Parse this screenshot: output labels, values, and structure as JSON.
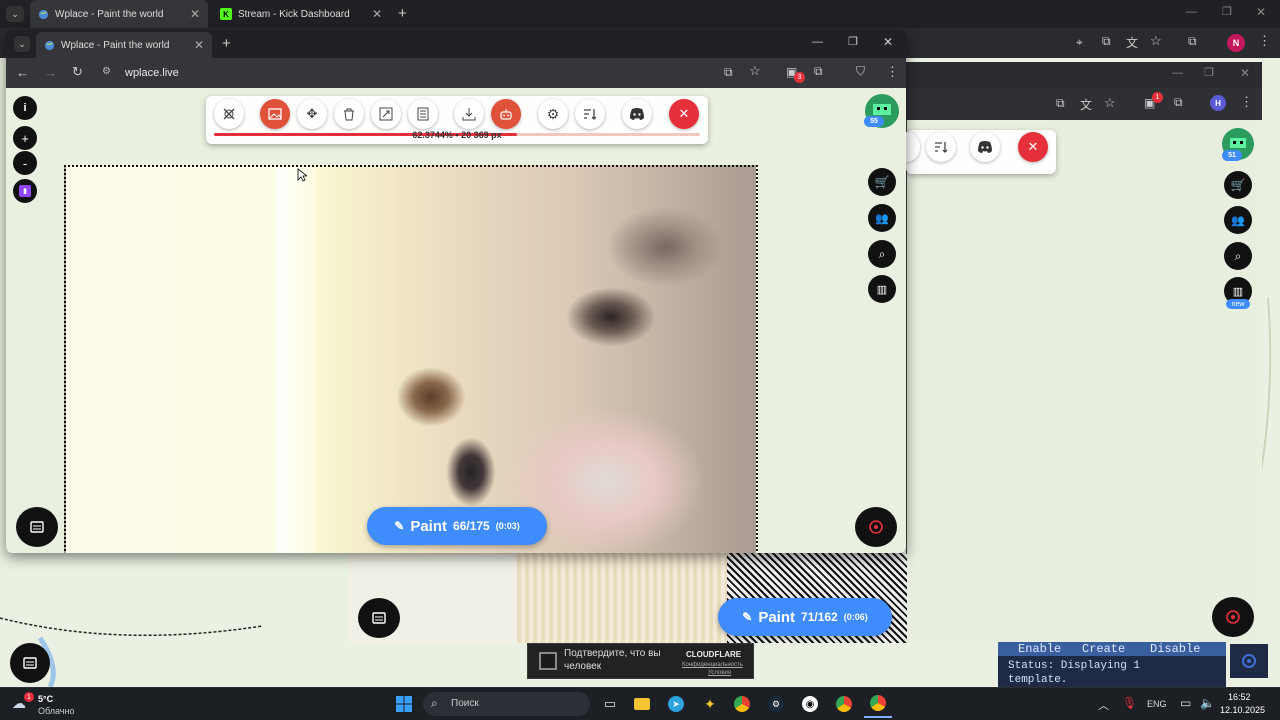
{
  "bg_browser": {
    "tabs": [
      {
        "label": "Wplace - Paint the world"
      },
      {
        "label": "Stream - Kick Dashboard"
      }
    ],
    "profile_initial": "N"
  },
  "front_window": {
    "tab_label": "Wplace - Paint the world",
    "url": "wplace.live",
    "extension_badge": "3",
    "progress_text": "62.3744% • 20 369 px",
    "progress_value": 0.6237,
    "level_badge": "55",
    "paint": {
      "label": "Paint",
      "count": "66/175",
      "timer": "(0:03)"
    }
  },
  "middle_window": {
    "level_badge": "51",
    "extension_badge": "1",
    "profile_initial": "H",
    "new_badge": "new",
    "paint": {
      "label": "Paint",
      "count": "71/162",
      "timer": "(0:06)"
    }
  },
  "cloudflare": {
    "text_line1": "Подтвердите, что вы",
    "text_line2": "человек",
    "brand": "CLOUDFLARE",
    "link1": "Конфиденциальность",
    "link2": "Условия"
  },
  "template_panel": {
    "buttons": [
      "Enable",
      "Create",
      "Disable"
    ],
    "status_line1": "Status: Displaying 1",
    "status_line2": "template."
  },
  "taskbar": {
    "weather_temp": "5°C",
    "weather_desc": "Облачно",
    "weather_badge": "1",
    "search_placeholder": "Поиск",
    "lang": "ENG",
    "time": "16:52",
    "date": "12.10.2025"
  },
  "colors": {
    "accent_blue": "#3f8cff",
    "close_red": "#e5303b",
    "orange": "#e0513a"
  }
}
